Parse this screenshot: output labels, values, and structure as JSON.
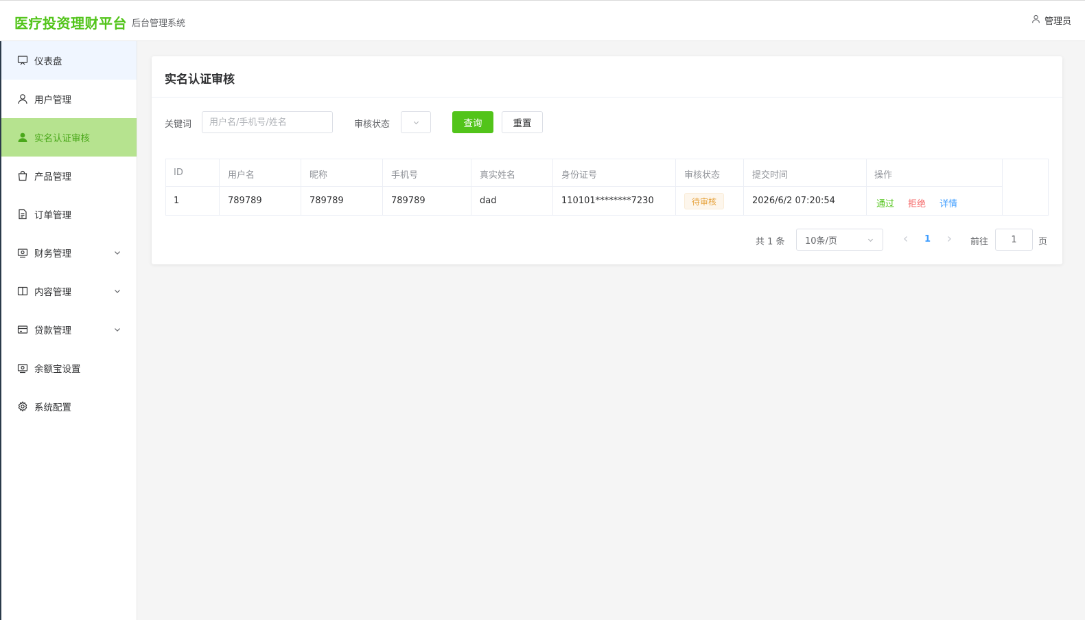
{
  "header": {
    "logo": "医疗投资理财平台",
    "subtitle": "后台管理系统",
    "user": "管理员"
  },
  "sidebar": {
    "items": [
      {
        "label": "仪表盘",
        "icon": "monitor-icon"
      },
      {
        "label": "用户管理",
        "icon": "user-icon"
      },
      {
        "label": "实名认证审核",
        "icon": "user-filled-icon",
        "active": true
      },
      {
        "label": "产品管理",
        "icon": "shopping-bag-icon"
      },
      {
        "label": "订单管理",
        "icon": "document-icon"
      },
      {
        "label": "财务管理",
        "icon": "wallet-icon",
        "expandable": true
      },
      {
        "label": "内容管理",
        "icon": "book-icon",
        "expandable": true
      },
      {
        "label": "贷款管理",
        "icon": "credit-card-icon",
        "expandable": true
      },
      {
        "label": "余额宝设置",
        "icon": "wallet-icon"
      },
      {
        "label": "系统配置",
        "icon": "gear-icon"
      }
    ]
  },
  "page": {
    "title": "实名认证审核"
  },
  "filters": {
    "keyword_label": "关键词",
    "keyword_placeholder": "用户名/手机号/姓名",
    "status_label": "审核状态",
    "query_button": "查询",
    "reset_button": "重置"
  },
  "table": {
    "columns": [
      "ID",
      "用户名",
      "昵称",
      "手机号",
      "真实姓名",
      "身份证号",
      "审核状态",
      "提交时间",
      "操作"
    ],
    "rows": [
      {
        "id": "1",
        "username": "789789",
        "nickname": "789789",
        "phone": "789789",
        "real_name": "dad",
        "id_number": "110101********7230",
        "status": "待审核",
        "submitted_at": "2026/6/2 07:20:54",
        "actions": {
          "approve": "通过",
          "reject": "拒绝",
          "detail": "详情"
        }
      }
    ]
  },
  "pagination": {
    "total": "共 1 条",
    "page_size": "10条/页",
    "current": "1",
    "goto_label": "前往",
    "goto_value": "1",
    "page_label": "页"
  },
  "colors": {
    "brand": "#52c41a",
    "active_menu_bg": "#b6e38f",
    "approve": "#52c41a",
    "reject": "#f56c6c",
    "detail": "#409eff",
    "pending_tag": "#e6a23c"
  }
}
